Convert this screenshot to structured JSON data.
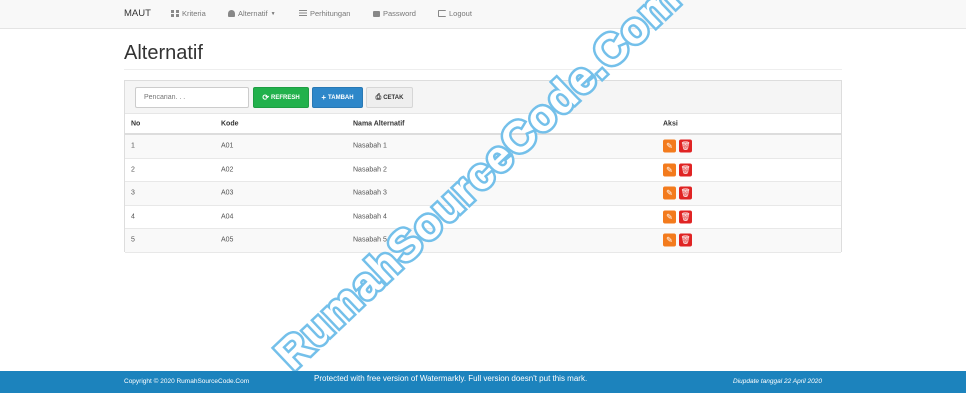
{
  "navbar": {
    "brand": "MAUT",
    "items": [
      {
        "label": "Kriteria",
        "icon": "grid-icon"
      },
      {
        "label": "Alternatif",
        "icon": "user-icon",
        "dropdown": true
      },
      {
        "label": "Perhitungan",
        "icon": "list-icon"
      },
      {
        "label": "Password",
        "icon": "lock-icon"
      },
      {
        "label": "Logout",
        "icon": "logout-icon"
      }
    ]
  },
  "page": {
    "title": "Alternatif"
  },
  "toolbar": {
    "search_placeholder": "Pencarian. . .",
    "refresh_label": "REFRESH",
    "tambah_label": "TAMBAH",
    "cetak_label": "CETAK"
  },
  "table": {
    "headers": [
      "No",
      "Kode",
      "Nama Alternatif",
      "Aksi"
    ],
    "rows": [
      {
        "no": "1",
        "kode": "A01",
        "nama": "Nasabah 1"
      },
      {
        "no": "2",
        "kode": "A02",
        "nama": "Nasabah 2"
      },
      {
        "no": "3",
        "kode": "A03",
        "nama": "Nasabah 3"
      },
      {
        "no": "4",
        "kode": "A04",
        "nama": "Nasabah 4"
      },
      {
        "no": "5",
        "kode": "A05",
        "nama": "Nasabah 5"
      }
    ]
  },
  "watermark": {
    "text": "RumahSourceCode.Com"
  },
  "footer": {
    "copyright": "Copyright © 2020 RumahSourceCode.Com",
    "notice": "Protected with free version of Watermarkly. Full version doesn't put this mark.",
    "updated": "Diupdate tanggal 22 April 2020"
  },
  "colors": {
    "refresh": "#22b14c",
    "tambah": "#2e87c9",
    "edit": "#f37b1d",
    "delete": "#e02424",
    "footer": "#1c83bd"
  }
}
